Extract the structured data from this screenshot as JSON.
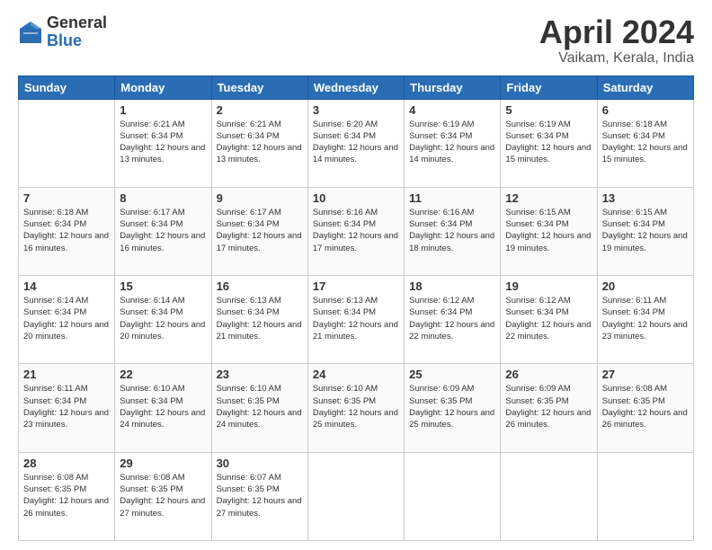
{
  "header": {
    "logo_general": "General",
    "logo_blue": "Blue",
    "title": "April 2024",
    "location": "Vaikam, Kerala, India"
  },
  "days_of_week": [
    "Sunday",
    "Monday",
    "Tuesday",
    "Wednesday",
    "Thursday",
    "Friday",
    "Saturday"
  ],
  "weeks": [
    [
      {
        "day": "",
        "sunrise": "",
        "sunset": "",
        "daylight": ""
      },
      {
        "day": "1",
        "sunrise": "Sunrise: 6:21 AM",
        "sunset": "Sunset: 6:34 PM",
        "daylight": "Daylight: 12 hours and 13 minutes."
      },
      {
        "day": "2",
        "sunrise": "Sunrise: 6:21 AM",
        "sunset": "Sunset: 6:34 PM",
        "daylight": "Daylight: 12 hours and 13 minutes."
      },
      {
        "day": "3",
        "sunrise": "Sunrise: 6:20 AM",
        "sunset": "Sunset: 6:34 PM",
        "daylight": "Daylight: 12 hours and 14 minutes."
      },
      {
        "day": "4",
        "sunrise": "Sunrise: 6:19 AM",
        "sunset": "Sunset: 6:34 PM",
        "daylight": "Daylight: 12 hours and 14 minutes."
      },
      {
        "day": "5",
        "sunrise": "Sunrise: 6:19 AM",
        "sunset": "Sunset: 6:34 PM",
        "daylight": "Daylight: 12 hours and 15 minutes."
      },
      {
        "day": "6",
        "sunrise": "Sunrise: 6:18 AM",
        "sunset": "Sunset: 6:34 PM",
        "daylight": "Daylight: 12 hours and 15 minutes."
      }
    ],
    [
      {
        "day": "7",
        "sunrise": "Sunrise: 6:18 AM",
        "sunset": "Sunset: 6:34 PM",
        "daylight": "Daylight: 12 hours and 16 minutes."
      },
      {
        "day": "8",
        "sunrise": "Sunrise: 6:17 AM",
        "sunset": "Sunset: 6:34 PM",
        "daylight": "Daylight: 12 hours and 16 minutes."
      },
      {
        "day": "9",
        "sunrise": "Sunrise: 6:17 AM",
        "sunset": "Sunset: 6:34 PM",
        "daylight": "Daylight: 12 hours and 17 minutes."
      },
      {
        "day": "10",
        "sunrise": "Sunrise: 6:16 AM",
        "sunset": "Sunset: 6:34 PM",
        "daylight": "Daylight: 12 hours and 17 minutes."
      },
      {
        "day": "11",
        "sunrise": "Sunrise: 6:16 AM",
        "sunset": "Sunset: 6:34 PM",
        "daylight": "Daylight: 12 hours and 18 minutes."
      },
      {
        "day": "12",
        "sunrise": "Sunrise: 6:15 AM",
        "sunset": "Sunset: 6:34 PM",
        "daylight": "Daylight: 12 hours and 19 minutes."
      },
      {
        "day": "13",
        "sunrise": "Sunrise: 6:15 AM",
        "sunset": "Sunset: 6:34 PM",
        "daylight": "Daylight: 12 hours and 19 minutes."
      }
    ],
    [
      {
        "day": "14",
        "sunrise": "Sunrise: 6:14 AM",
        "sunset": "Sunset: 6:34 PM",
        "daylight": "Daylight: 12 hours and 20 minutes."
      },
      {
        "day": "15",
        "sunrise": "Sunrise: 6:14 AM",
        "sunset": "Sunset: 6:34 PM",
        "daylight": "Daylight: 12 hours and 20 minutes."
      },
      {
        "day": "16",
        "sunrise": "Sunrise: 6:13 AM",
        "sunset": "Sunset: 6:34 PM",
        "daylight": "Daylight: 12 hours and 21 minutes."
      },
      {
        "day": "17",
        "sunrise": "Sunrise: 6:13 AM",
        "sunset": "Sunset: 6:34 PM",
        "daylight": "Daylight: 12 hours and 21 minutes."
      },
      {
        "day": "18",
        "sunrise": "Sunrise: 6:12 AM",
        "sunset": "Sunset: 6:34 PM",
        "daylight": "Daylight: 12 hours and 22 minutes."
      },
      {
        "day": "19",
        "sunrise": "Sunrise: 6:12 AM",
        "sunset": "Sunset: 6:34 PM",
        "daylight": "Daylight: 12 hours and 22 minutes."
      },
      {
        "day": "20",
        "sunrise": "Sunrise: 6:11 AM",
        "sunset": "Sunset: 6:34 PM",
        "daylight": "Daylight: 12 hours and 23 minutes."
      }
    ],
    [
      {
        "day": "21",
        "sunrise": "Sunrise: 6:11 AM",
        "sunset": "Sunset: 6:34 PM",
        "daylight": "Daylight: 12 hours and 23 minutes."
      },
      {
        "day": "22",
        "sunrise": "Sunrise: 6:10 AM",
        "sunset": "Sunset: 6:34 PM",
        "daylight": "Daylight: 12 hours and 24 minutes."
      },
      {
        "day": "23",
        "sunrise": "Sunrise: 6:10 AM",
        "sunset": "Sunset: 6:35 PM",
        "daylight": "Daylight: 12 hours and 24 minutes."
      },
      {
        "day": "24",
        "sunrise": "Sunrise: 6:10 AM",
        "sunset": "Sunset: 6:35 PM",
        "daylight": "Daylight: 12 hours and 25 minutes."
      },
      {
        "day": "25",
        "sunrise": "Sunrise: 6:09 AM",
        "sunset": "Sunset: 6:35 PM",
        "daylight": "Daylight: 12 hours and 25 minutes."
      },
      {
        "day": "26",
        "sunrise": "Sunrise: 6:09 AM",
        "sunset": "Sunset: 6:35 PM",
        "daylight": "Daylight: 12 hours and 26 minutes."
      },
      {
        "day": "27",
        "sunrise": "Sunrise: 6:08 AM",
        "sunset": "Sunset: 6:35 PM",
        "daylight": "Daylight: 12 hours and 26 minutes."
      }
    ],
    [
      {
        "day": "28",
        "sunrise": "Sunrise: 6:08 AM",
        "sunset": "Sunset: 6:35 PM",
        "daylight": "Daylight: 12 hours and 26 minutes."
      },
      {
        "day": "29",
        "sunrise": "Sunrise: 6:08 AM",
        "sunset": "Sunset: 6:35 PM",
        "daylight": "Daylight: 12 hours and 27 minutes."
      },
      {
        "day": "30",
        "sunrise": "Sunrise: 6:07 AM",
        "sunset": "Sunset: 6:35 PM",
        "daylight": "Daylight: 12 hours and 27 minutes."
      },
      {
        "day": "",
        "sunrise": "",
        "sunset": "",
        "daylight": ""
      },
      {
        "day": "",
        "sunrise": "",
        "sunset": "",
        "daylight": ""
      },
      {
        "day": "",
        "sunrise": "",
        "sunset": "",
        "daylight": ""
      },
      {
        "day": "",
        "sunrise": "",
        "sunset": "",
        "daylight": ""
      }
    ]
  ]
}
